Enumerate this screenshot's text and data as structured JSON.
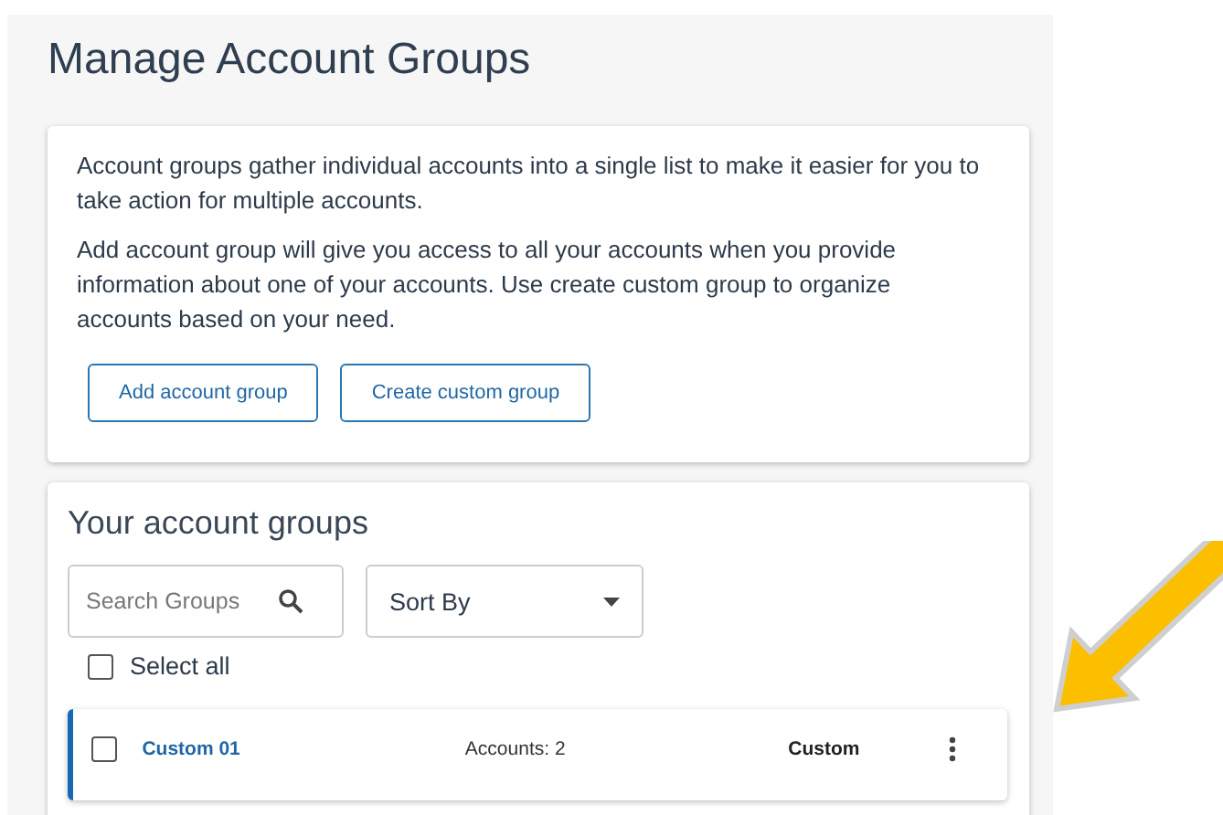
{
  "title": "Manage Account Groups",
  "intro": {
    "paragraphs": [
      "Account groups gather individual accounts into a single list to make it easier for you to take action for multiple accounts.",
      "Add account group will give you access to all your accounts when you provide information about one of your accounts. Use create custom group to organize accounts based on your need."
    ],
    "buttons": [
      "Add account group",
      "Create custom group"
    ]
  },
  "groups": {
    "heading": "Your account groups",
    "search": {
      "placeholder": "Search Groups"
    },
    "sort": {
      "value": "Sort By"
    },
    "select_all": {
      "label": "Select all",
      "checked": false
    },
    "rows": [
      {
        "name": "Custom 01",
        "accounts": "Accounts: 2",
        "type": "Custom",
        "checked": false
      }
    ]
  }
}
